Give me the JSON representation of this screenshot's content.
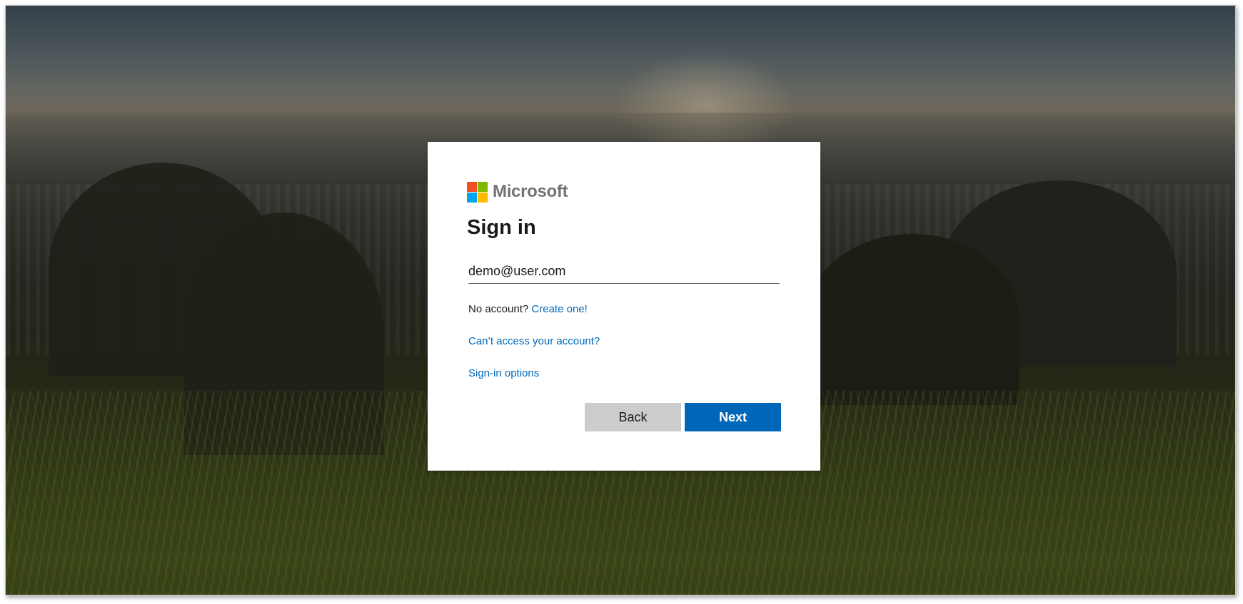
{
  "brand": {
    "name": "Microsoft",
    "logo_colors": [
      "#f25022",
      "#7fba00",
      "#00a4ef",
      "#ffb900"
    ]
  },
  "signin": {
    "title": "Sign in",
    "email_value": "demo@user.com",
    "no_account_text": "No account?",
    "create_link": "Create one!",
    "cant_access_link": "Can’t access your account?",
    "signin_options_link": "Sign-in options",
    "back_label": "Back",
    "next_label": "Next"
  },
  "colors": {
    "accent": "#0067b8",
    "back_button": "#cccccc"
  }
}
